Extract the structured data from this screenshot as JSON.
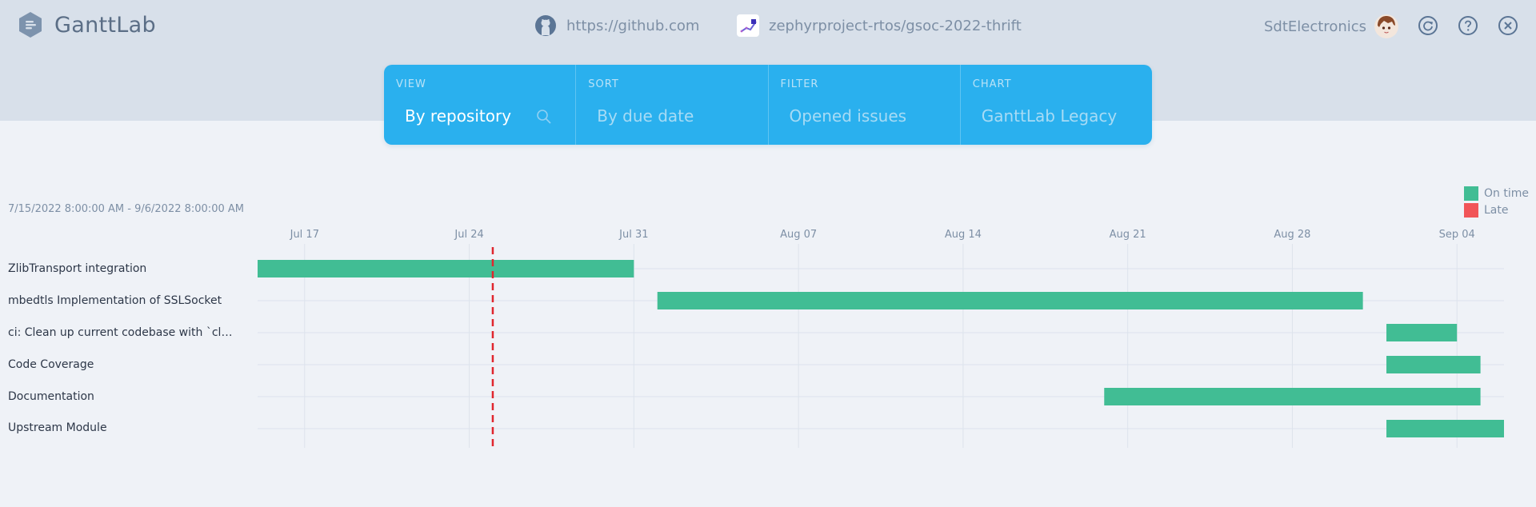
{
  "app": {
    "title": "GanttLab"
  },
  "source": {
    "host_url": "https://github.com",
    "repo": "zephyrproject-rtos/gsoc-2022-thrift"
  },
  "user": {
    "name": "SdtElectronics"
  },
  "icons": {
    "logo": "hexagon-logo-icon",
    "host": "github-icon",
    "repo": "repository-avatar-icon",
    "refresh": "refresh-icon",
    "help": "help-icon",
    "close": "close-icon",
    "search": "search-icon"
  },
  "toolbar": {
    "view": {
      "label": "VIEW",
      "value": "By repository"
    },
    "sort": {
      "label": "SORT",
      "value": "By due date"
    },
    "filter": {
      "label": "FILTER",
      "value": "Opened issues"
    },
    "chart": {
      "label": "CHART",
      "value": "GanttLab Legacy"
    }
  },
  "colors": {
    "on_time": "#41bd94",
    "late": "#f15558",
    "today_marker": "#e0262e",
    "accent": "#2ab0ee"
  },
  "chart_data": {
    "type": "gantt",
    "range_text": "7/15/2022 8:00:00 AM - 9/6/2022 8:00:00 AM",
    "x_start": "2022-07-15",
    "x_end": "2022-09-06",
    "ticks": [
      {
        "label": "Jul 17",
        "date": "2022-07-17"
      },
      {
        "label": "Jul 24",
        "date": "2022-07-24"
      },
      {
        "label": "Jul 31",
        "date": "2022-07-31"
      },
      {
        "label": "Aug 07",
        "date": "2022-08-07"
      },
      {
        "label": "Aug 14",
        "date": "2022-08-14"
      },
      {
        "label": "Aug 21",
        "date": "2022-08-21"
      },
      {
        "label": "Aug 28",
        "date": "2022-08-28"
      },
      {
        "label": "Sep 04",
        "date": "2022-09-04"
      }
    ],
    "today": "2022-07-25",
    "legend": [
      {
        "label": "On time",
        "status": "on_time"
      },
      {
        "label": "Late",
        "status": "late"
      }
    ],
    "tasks": [
      {
        "name": "ZlibTransport integration",
        "start": "2022-07-15",
        "end": "2022-07-31",
        "status": "on_time"
      },
      {
        "name": "mbedtls Implementation of SSLSocket",
        "start": "2022-08-01",
        "end": "2022-08-31",
        "status": "on_time"
      },
      {
        "name": "ci: Clean up current codebase with `clang-...",
        "start": "2022-09-01",
        "end": "2022-09-04",
        "status": "on_time"
      },
      {
        "name": "Code Coverage",
        "start": "2022-09-01",
        "end": "2022-09-05",
        "status": "on_time"
      },
      {
        "name": "Documentation",
        "start": "2022-08-20",
        "end": "2022-09-05",
        "status": "on_time"
      },
      {
        "name": "Upstream Module",
        "start": "2022-09-01",
        "end": "2022-09-06",
        "status": "on_time"
      }
    ]
  }
}
